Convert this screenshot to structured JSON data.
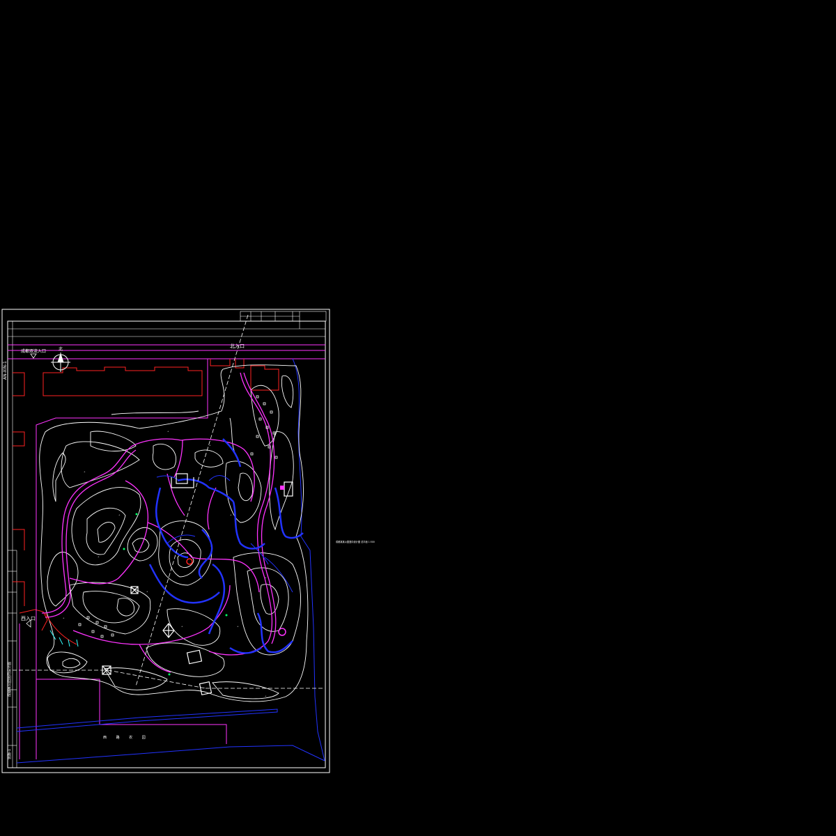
{
  "drawing": {
    "labels": {
      "north_entrance": "北入口",
      "west_entrance": "西入口",
      "top_left_entrance": "成都双流入口",
      "north_symbol_text": "北",
      "side_code": "AN-XIN-1",
      "street_text": "西 路 农 园",
      "outside_note": "成都某某公园竖向设计图 总平面 1:500"
    },
    "title_block": {
      "project": "成都某公园竖向设计图",
      "drawing_no": "竖施-1"
    },
    "colors": {
      "background": "#000000",
      "frame": "#ffffff",
      "contour": "#ffffff",
      "path": "#ff33ff",
      "water": "#2233ff",
      "boundary": "#ff2222",
      "axis": "#ffffff",
      "spot": "#00ff66",
      "accent_cyan": "#33ffff"
    }
  }
}
